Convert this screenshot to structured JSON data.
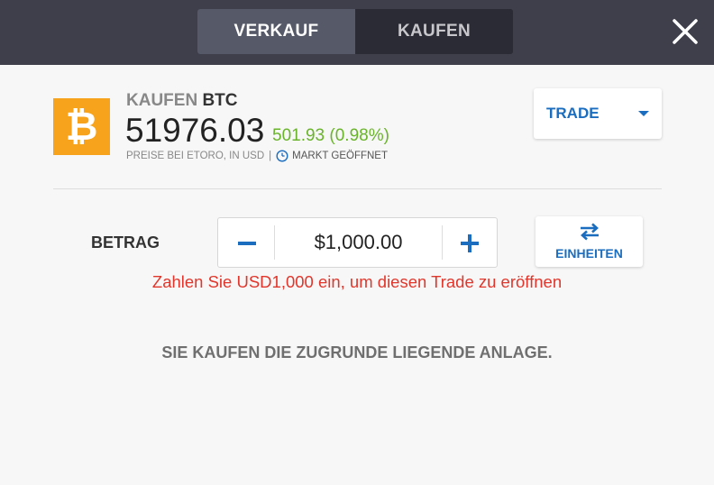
{
  "mode_toggle": {
    "sell_label": "VERKAUF",
    "buy_label": "KAUFEN",
    "active": "VERKAUF"
  },
  "close_icon": "close-icon",
  "instrument": {
    "icon": "bitcoin-icon",
    "logo_glyph": "₿",
    "action_label": "KAUFEN",
    "symbol": "BTC",
    "price": "51976.03",
    "change": "501.93 (0.98%)",
    "price_source": "PREISE BEI ETORO, IN USD",
    "separator": "|",
    "market_status": "MARKT GEÖFFNET"
  },
  "order_type": {
    "label": "TRADE"
  },
  "amount": {
    "label": "BETRAG",
    "value": "$1,000.00"
  },
  "units_button": {
    "label": "EINHEITEN"
  },
  "error_message": "Zahlen Sie USD1,000 ein, um diesen Trade zu eröffnen",
  "info_message": "SIE KAUFEN DIE ZUGRUNDE LIEGENDE ANLAGE.",
  "colors": {
    "topbar": "#3e3f4b",
    "accent_blue": "#1a6dbf",
    "positive_green": "#6ab42b",
    "error_red": "#e0362b",
    "bitcoin_orange": "#f7a31c"
  }
}
